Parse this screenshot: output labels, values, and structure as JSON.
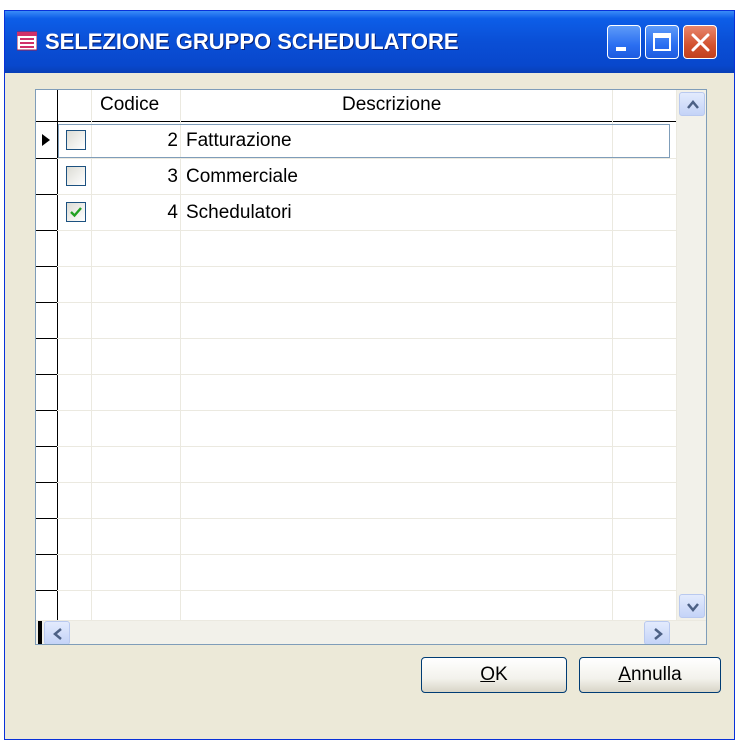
{
  "window": {
    "title": "SELEZIONE GRUPPO SCHEDULATORE",
    "icon": "form-window-icon",
    "controls": {
      "minimize": "minimize-icon",
      "maximize": "maximize-icon",
      "close": "close-icon"
    }
  },
  "grid": {
    "columns": [
      "Codice",
      "Descrizione"
    ],
    "rows": [
      {
        "checked": false,
        "code": "2",
        "description": "Fatturazione",
        "current": true
      },
      {
        "checked": false,
        "code": "3",
        "description": "Commerciale",
        "current": false
      },
      {
        "checked": true,
        "code": "4",
        "description": "Schedulatori",
        "current": false
      }
    ]
  },
  "buttons": {
    "ok": {
      "label": "OK",
      "accelerator": "O",
      "rest": "K"
    },
    "cancel": {
      "label": "Annulla",
      "accelerator": "A",
      "rest": "nnulla"
    }
  },
  "colors": {
    "titlebar": "#0a4fd6",
    "check": "#21a121"
  }
}
